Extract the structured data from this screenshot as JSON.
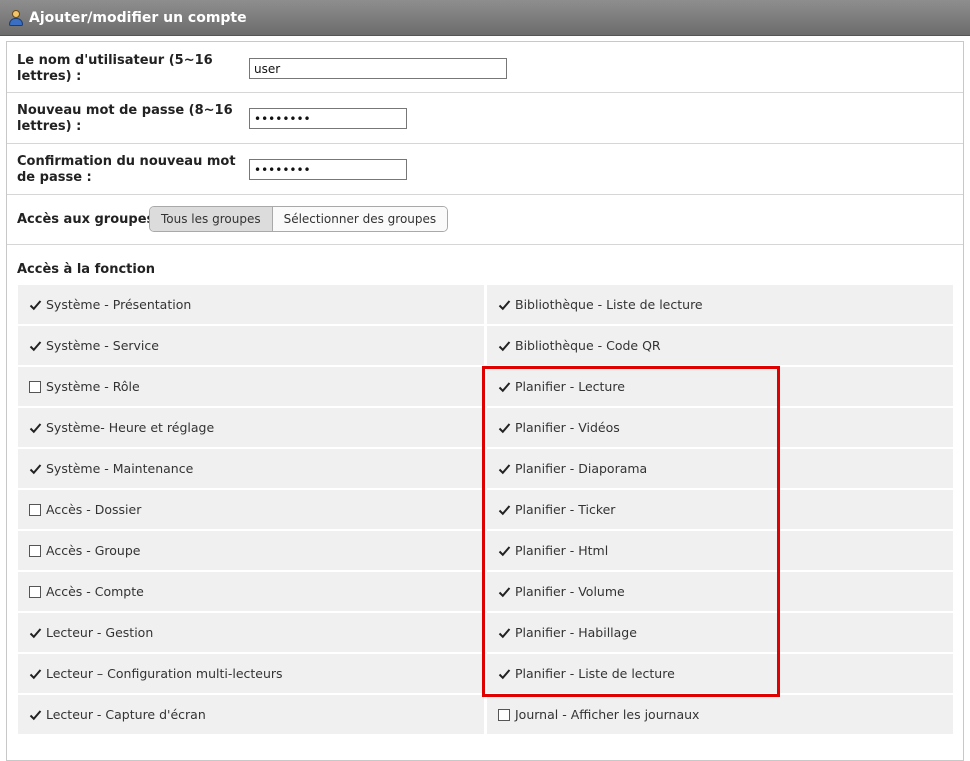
{
  "window": {
    "title": "Ajouter/modifier un compte",
    "icon": "user-icon"
  },
  "form": {
    "username_label": "Le nom d'utilisateur (5~16 lettres) :",
    "username_value": "user",
    "password_label": "Nouveau mot de passe (8~16 lettres) :",
    "password_value": "••••••••",
    "confirm_label": "Confirmation du nouveau mot de passe :",
    "confirm_value": "••••••••",
    "group_access_label": "Accès aux groupes",
    "group_options": [
      "Tous les groupes",
      "Sélectionner des groupes"
    ],
    "group_selected": "Tous les groupes"
  },
  "functions": {
    "title": "Accès à la fonction",
    "left": [
      {
        "label": "Système - Présentation",
        "checked": true
      },
      {
        "label": "Système - Service",
        "checked": true
      },
      {
        "label": "Système - Rôle",
        "checked": false
      },
      {
        "label": "Système- Heure et réglage",
        "checked": true
      },
      {
        "label": "Système - Maintenance",
        "checked": true
      },
      {
        "label": "Accès - Dossier",
        "checked": false
      },
      {
        "label": "Accès - Groupe",
        "checked": false
      },
      {
        "label": "Accès - Compte",
        "checked": false
      },
      {
        "label": "Lecteur - Gestion",
        "checked": true
      },
      {
        "label": "Lecteur – Configuration multi-lecteurs",
        "checked": true
      },
      {
        "label": "Lecteur - Capture d'écran",
        "checked": true
      }
    ],
    "right": [
      {
        "label": "Bibliothèque - Liste de lecture",
        "checked": true
      },
      {
        "label": "Bibliothèque - Code QR",
        "checked": true
      },
      {
        "label": "Planifier - Lecture",
        "checked": true
      },
      {
        "label": "Planifier - Vidéos",
        "checked": true
      },
      {
        "label": "Planifier - Diaporama",
        "checked": true
      },
      {
        "label": "Planifier - Ticker",
        "checked": true
      },
      {
        "label": "Planifier - Html",
        "checked": true
      },
      {
        "label": "Planifier - Volume",
        "checked": true
      },
      {
        "label": "Planifier - Habillage",
        "checked": true
      },
      {
        "label": "Planifier - Liste de lecture",
        "checked": true
      },
      {
        "label": "Journal - Afficher les journaux",
        "checked": false
      }
    ]
  },
  "highlight_color": "#e00000"
}
